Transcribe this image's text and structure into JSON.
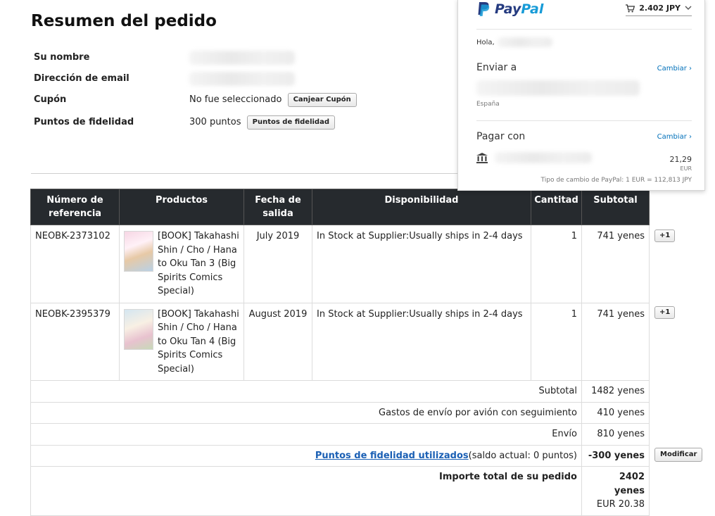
{
  "page": {
    "title": "Resumen del pedido"
  },
  "info": {
    "name_label": "Su nombre",
    "email_label": "Dirección de email",
    "coupon_label": "Cupón",
    "coupon_value": "No fue seleccionado",
    "coupon_button": "Canjear Cupón",
    "points_label": "Puntos de fidelidad",
    "points_value": "300 puntos",
    "points_button": "Puntos de fidelidad"
  },
  "table": {
    "headers": [
      "Número de referencia",
      "Productos",
      "Fecha de salida",
      "Disponibilidad",
      "Cantitad",
      "Subtotal"
    ],
    "rows": [
      {
        "ref": "NEOBK-2373102",
        "product": "[BOOK] Takahashi Shin / Cho / Hana to Oku Tan 3 (Big Spirits Comics Special)",
        "date": "July 2019",
        "availability": "In Stock at Supplier:Usually ships in 2-4 days",
        "qty": "1",
        "subtotal": "741 yenes",
        "add_button": "+1"
      },
      {
        "ref": "NEOBK-2395379",
        "product": "[BOOK] Takahashi Shin / Cho / Hana to Oku Tan 4 (Big Spirits Comics Special)",
        "date": "August 2019",
        "availability": "In Stock at Supplier:Usually ships in 2-4 days",
        "qty": "1",
        "subtotal": "741 yenes",
        "add_button": "+1"
      }
    ]
  },
  "summary": {
    "subtotal_label": "Subtotal",
    "subtotal_value": "1482 yenes",
    "airmail_label": "Gastos de envío por avión con seguimiento",
    "airmail_value": "410 yenes",
    "shipping_label": "Envío",
    "shipping_value": "810 yenes",
    "points_link": "Puntos de fidelidad utilizados",
    "points_note": "(saldo actual: 0 puntos)",
    "points_value": "-300 yenes",
    "modify_button": "Modificar",
    "total_label": "Importe total de su pedido",
    "total_value": "2402 yenes",
    "total_eur": "EUR 20.38"
  },
  "paypal": {
    "brand_pay": "Pay",
    "brand_pal": "Pal",
    "cart_total": "2.402 JPY",
    "greeting": "Hola,",
    "ship_heading": "Enviar a",
    "ship_change": "Cambiar ›",
    "ship_country": "España",
    "pay_heading": "Pagar con",
    "pay_change": "Cambiar ›",
    "pay_amount": "21,29",
    "pay_currency": "EUR",
    "exchange_rate": "Tipo de cambio de PayPal: 1 EUR = 112,813 JPY"
  }
}
